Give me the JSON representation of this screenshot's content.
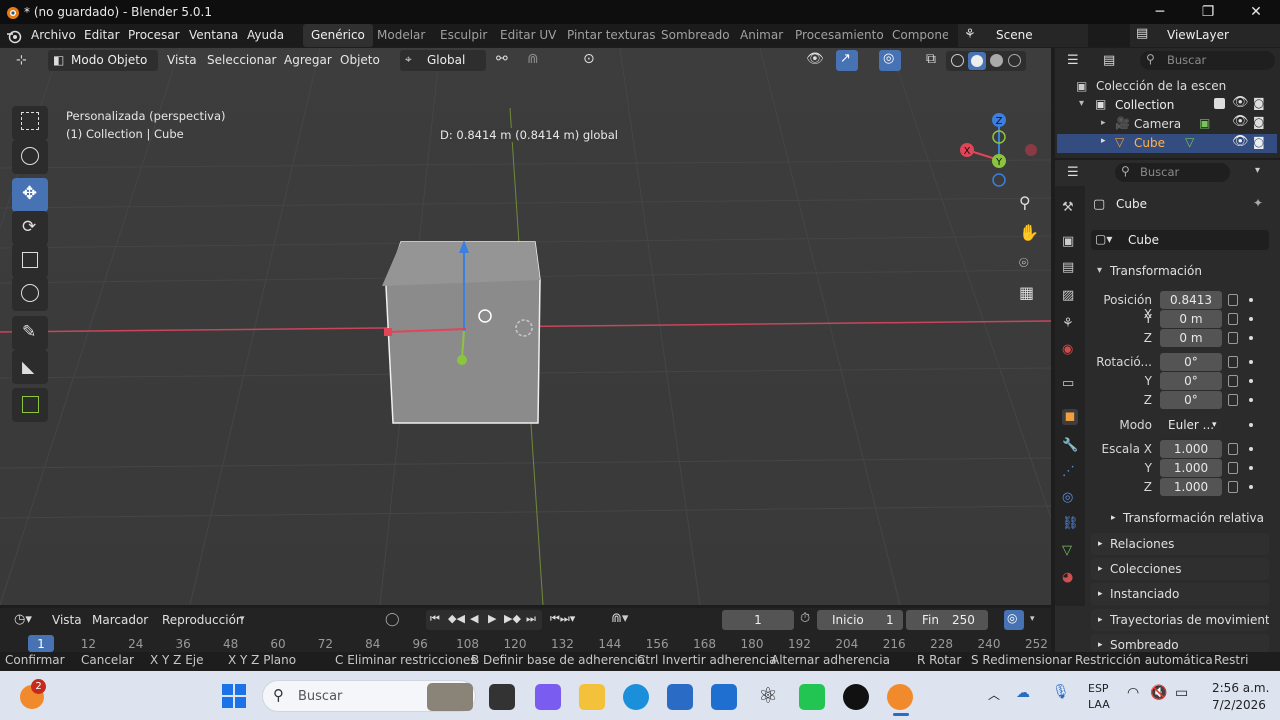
{
  "window": {
    "title": "* (no guardado) - Blender 5.0.1",
    "min": "─",
    "max": "❐",
    "close": "✕"
  },
  "menubar": {
    "items": [
      "Archivo",
      "Editar",
      "Procesar",
      "Ventana",
      "Ayuda"
    ],
    "workspaces": [
      "Genérico",
      "Modelar",
      "Esculpir",
      "Editar UV",
      "Pintar texturas",
      "Sombreado",
      "Animar",
      "Procesamiento",
      "Componer"
    ],
    "scene": "Scene",
    "view_layer": "ViewLayer"
  },
  "viewport_header": {
    "mode": "Modo Objeto",
    "menus": [
      "Vista",
      "Seleccionar",
      "Agregar",
      "Objeto"
    ],
    "orientation": "Global"
  },
  "viewport": {
    "operation_info": "D: 0.8414 m (0.8414 m) global",
    "view_name": "Personalizada (perspectiva)",
    "context": "(1) Collection | Cube",
    "gizmo_axes": {
      "x": "X",
      "y": "Y",
      "z": "Z"
    },
    "icons": [
      "select-box-icon",
      "cursor-icon",
      "move-icon",
      "rotate-icon",
      "scale-icon",
      "transform-icon",
      "annotate-icon",
      "measure-icon",
      "add-cube-icon"
    ]
  },
  "outliner": {
    "search_placeholder": "Buscar",
    "root": "Colección de la escen",
    "collection": "Collection",
    "items": [
      "Camera",
      "Cube"
    ]
  },
  "properties": {
    "search_placeholder": "Buscar",
    "object_name": "Cube",
    "datablock": "Cube",
    "panel_transform": "Transformación",
    "labels": {
      "position_x": "Posición X",
      "y": "Y",
      "z": "Z",
      "rotation": "Rotació...",
      "mode": "Modo",
      "scale_x": "Escala X"
    },
    "position": [
      "0.8413",
      "0 m",
      "0 m"
    ],
    "rotation": [
      "0°",
      "0°",
      "0°"
    ],
    "rotation_mode": "Euler ...",
    "scale": [
      "1.000",
      "1.000",
      "1.000"
    ],
    "subpanels": [
      "Transformación relativa",
      "Relaciones",
      "Colecciones",
      "Instanciado",
      "Trayectorias de movimient",
      "Sombreado"
    ]
  },
  "timeline": {
    "menus": [
      "Vista",
      "Marcador",
      "Reproducción"
    ],
    "current_frame": "1",
    "start_label": "Inicio",
    "start": "1",
    "end_label": "Fin",
    "end": "250",
    "frames": [
      "1",
      "12",
      "24",
      "36",
      "48",
      "60",
      "72",
      "84",
      "96",
      "108",
      "120",
      "132",
      "144",
      "156",
      "168",
      "180",
      "192",
      "204",
      "216",
      "228",
      "240",
      "252"
    ]
  },
  "statusbar": {
    "items": [
      "Confirmar",
      "Cancelar",
      "X Y Z Eje",
      "X Y Z Plano",
      "C Eliminar restricciones",
      "B Definir base de adherencia",
      "Ctrl Invertir adherencia",
      "Alternar adherencia",
      "R Rotar",
      "S Redimensionar",
      "Restricción automática",
      "Restri"
    ]
  },
  "taskbar": {
    "search_placeholder": "Buscar",
    "notification_count": "2",
    "lang": "ESP",
    "layout": "LAA",
    "time": "2:56 a.m.",
    "date": "7/2/2026"
  },
  "colors": {
    "accent": "#4772b3",
    "x_axis": "#e24458",
    "y_axis": "#8bc53f",
    "z_axis": "#3b80e0",
    "selected_row": "#334d80"
  }
}
